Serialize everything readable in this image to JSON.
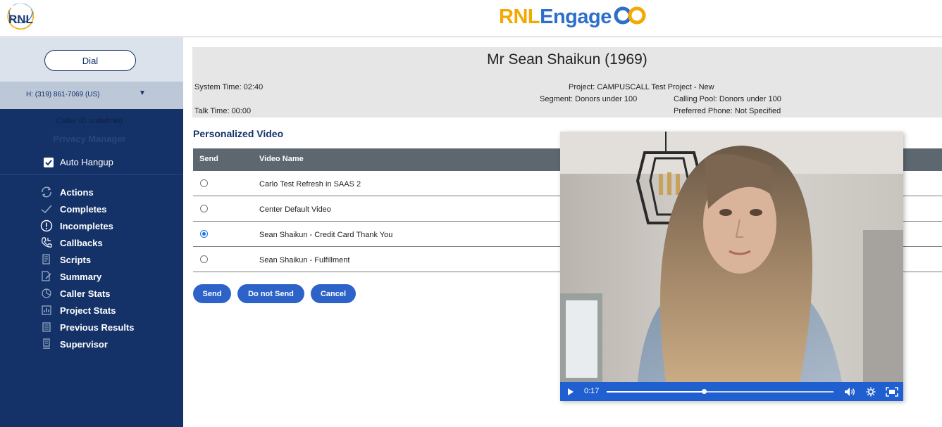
{
  "header": {
    "logo_text": "RNL",
    "brand_part1": "RNL",
    "brand_part2": "Engage"
  },
  "sidebar": {
    "dial_label": "Dial",
    "phone": "H: (319) 861-7069 (US)",
    "caller_id": "Caller ID undefined",
    "privacy_manager": "Privacy Manager",
    "auto_hangup_label": "Auto Hangup",
    "auto_hangup_checked": true,
    "nav": [
      {
        "label": "Actions",
        "icon": "refresh-icon"
      },
      {
        "label": "Completes",
        "icon": "checkmark-icon"
      },
      {
        "label": "Incompletes",
        "icon": "exclamation-circle-icon"
      },
      {
        "label": "Callbacks",
        "icon": "phone-callback-icon"
      },
      {
        "label": "Scripts",
        "icon": "script-document-icon"
      },
      {
        "label": "Summary",
        "icon": "summary-edit-icon"
      },
      {
        "label": "Caller Stats",
        "icon": "caller-stats-icon"
      },
      {
        "label": "Project Stats",
        "icon": "project-stats-icon"
      },
      {
        "label": "Previous Results",
        "icon": "previous-results-icon"
      },
      {
        "label": "Supervisor",
        "icon": "supervisor-icon"
      }
    ]
  },
  "contact": {
    "name": "Mr Sean Shaikun (1969)",
    "system_time": "System Time: 02:40",
    "talk_time": "Talk Time: 00:00",
    "project": "Project: CAMPUSCALL Test Project - New",
    "segment": "Segment: Donors under 100",
    "calling_pool": "Calling Pool: Donors under 100",
    "preferred_phone": "Preferred Phone:  Not Specified"
  },
  "personalized_video": {
    "title": "Personalized Video",
    "columns": [
      "Send",
      "Video Name"
    ],
    "rows": [
      {
        "name": "Carlo Test Refresh in SAAS 2",
        "selected": false
      },
      {
        "name": "Center Default Video",
        "selected": false
      },
      {
        "name": "Sean Shaikun - Credit Card Thank You",
        "selected": true
      },
      {
        "name": "Sean Shaikun - Fulfillment",
        "selected": false
      }
    ],
    "buttons": {
      "send": "Send",
      "do_not_send": "Do not Send",
      "cancel": "Cancel"
    }
  },
  "video_player": {
    "current_time": "0:17",
    "progress_fraction": 0.43,
    "accent_color": "#1f5fcf"
  },
  "colors": {
    "sidebar_bg": "#143268",
    "button_bg": "#2d63c8",
    "brand_yellow": "#f2a900",
    "brand_blue": "#2d6fc9",
    "table_header_bg": "#5c6770"
  }
}
